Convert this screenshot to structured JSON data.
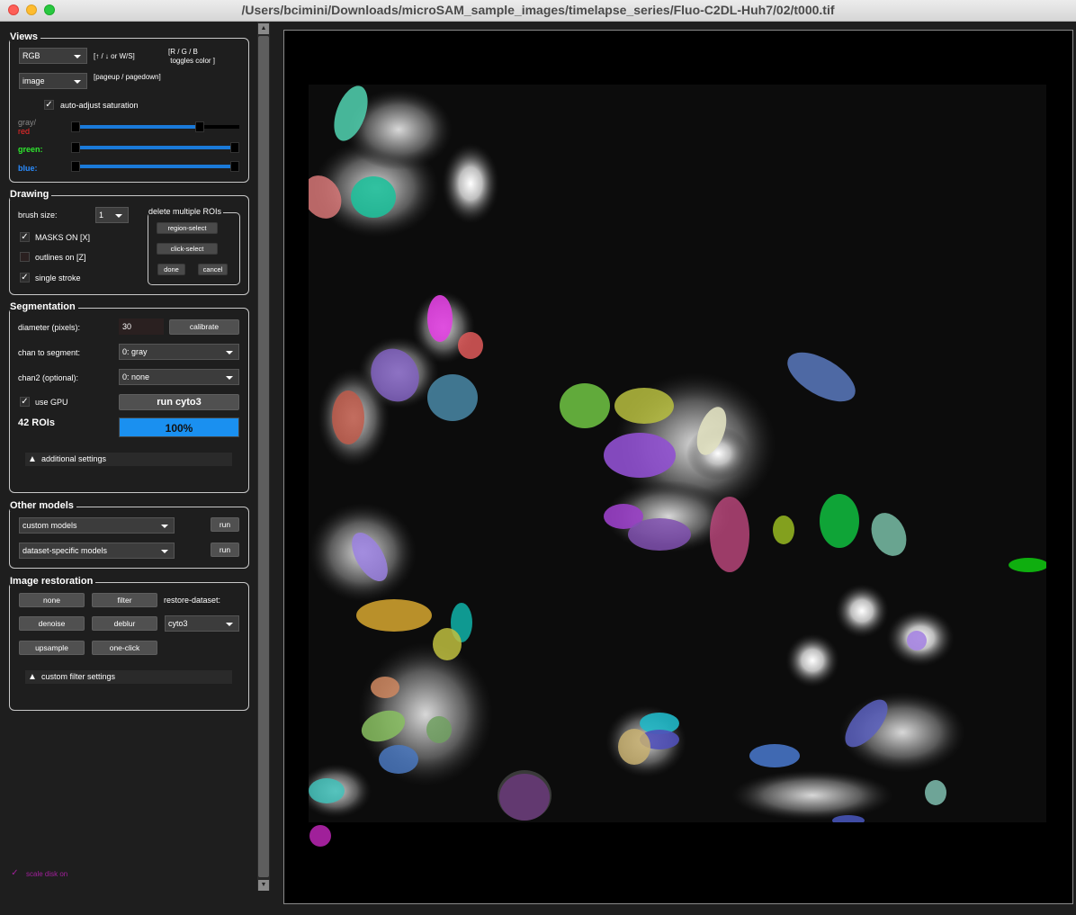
{
  "window": {
    "title": "/Users/bcimini/Downloads/microSAM_sample_images/timelapse_series/Fluo-C2DL-Huh7/02/t000.tif"
  },
  "views": {
    "title": "Views",
    "color_mode": "RGB",
    "color_hint": "[↑ / ↓ or W/S]",
    "rgb_hint": "[R / G / B\n toggles color ]",
    "view_mode": "image",
    "view_hint": "[pageup / pagedown]",
    "auto_adjust_label": "auto-adjust saturation",
    "auto_adjust_checked": true,
    "gray_label": "gray/",
    "red_label": "red",
    "green_label": "green:",
    "blue_label": "blue:",
    "gray_range": [
      0,
      0.79
    ],
    "green_range": [
      0,
      1
    ],
    "blue_range": [
      0,
      1
    ]
  },
  "drawing": {
    "title": "Drawing",
    "brush_label": "brush size:",
    "brush_value": "1",
    "masks_label": "MASKS ON [X]",
    "masks_checked": true,
    "outlines_label": "outlines on [Z]",
    "outlines_checked": false,
    "single_stroke_label": "single stroke",
    "single_stroke_checked": true,
    "delete_group_label": "delete multiple ROIs",
    "region_select": "region-select",
    "click_select": "click-select",
    "done": "done",
    "cancel": "cancel"
  },
  "segmentation": {
    "title": "Segmentation",
    "diameter_label": "diameter (pixels):",
    "diameter_value": "30",
    "calibrate": "calibrate",
    "chan_label": "chan to segment:",
    "chan_value": "0: gray",
    "chan2_label": "chan2 (optional):",
    "chan2_value": "0: none",
    "gpu_label": "use GPU",
    "gpu_checked": true,
    "run_label": "run cyto3",
    "rois_label": "42 ROIs",
    "progress_text": "100%",
    "progress": 1.0,
    "additional_settings": "additional settings"
  },
  "other_models": {
    "title": "Other models",
    "custom_models": "custom models",
    "dataset_models": "dataset-specific models",
    "run1": "run",
    "run2": "run"
  },
  "restoration": {
    "title": "Image restoration",
    "none": "none",
    "filter": "filter",
    "restore_dataset_label": "restore-dataset:",
    "denoise": "denoise",
    "deblur": "deblur",
    "dataset_value": "cyto3",
    "upsample": "upsample",
    "one_click": "one-click",
    "custom_filter": "custom filter settings"
  },
  "scale_disk": {
    "label": "scale disk on",
    "checked": true,
    "color": "#a0209a"
  }
}
